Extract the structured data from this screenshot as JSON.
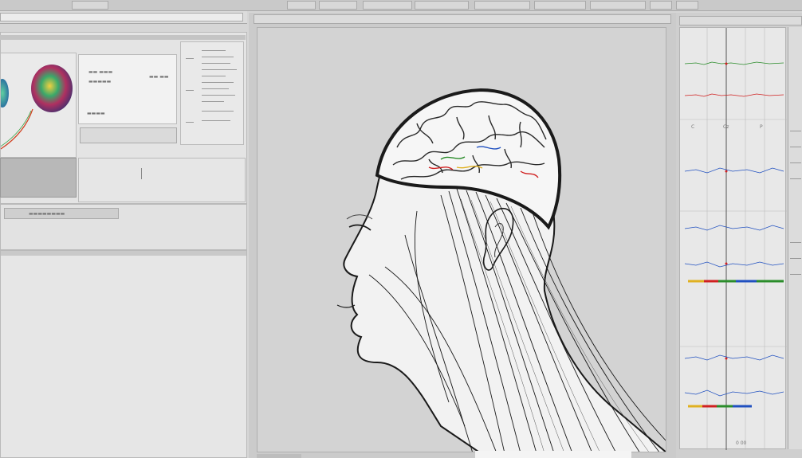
{
  "app": {
    "title": ""
  },
  "toolbar": {
    "items": [
      "",
      "",
      "",
      "",
      "",
      "",
      "",
      ""
    ]
  },
  "left": {
    "preview_lines": [
      "▬▬ ▬▬▬",
      "▬▬▬▬▬",
      "▬▬ ▬▬",
      "▬▬▬▬"
    ],
    "status": "▬▬▬▬▬▬▬▬"
  },
  "viewer": {
    "caption": ""
  },
  "waveforms": {
    "axis_labels_top": [
      "C",
      "Cz",
      "P"
    ],
    "footer": "0    00"
  },
  "colors": {
    "background": "#d6d6d6",
    "panel": "#e4e4e4",
    "canvas": "#d3d3d3",
    "stroke": "#1a1a1a",
    "accent_red": "#d02020",
    "accent_green": "#2a8c2a",
    "accent_blue": "#2050c0",
    "accent_yellow": "#e0b020"
  }
}
